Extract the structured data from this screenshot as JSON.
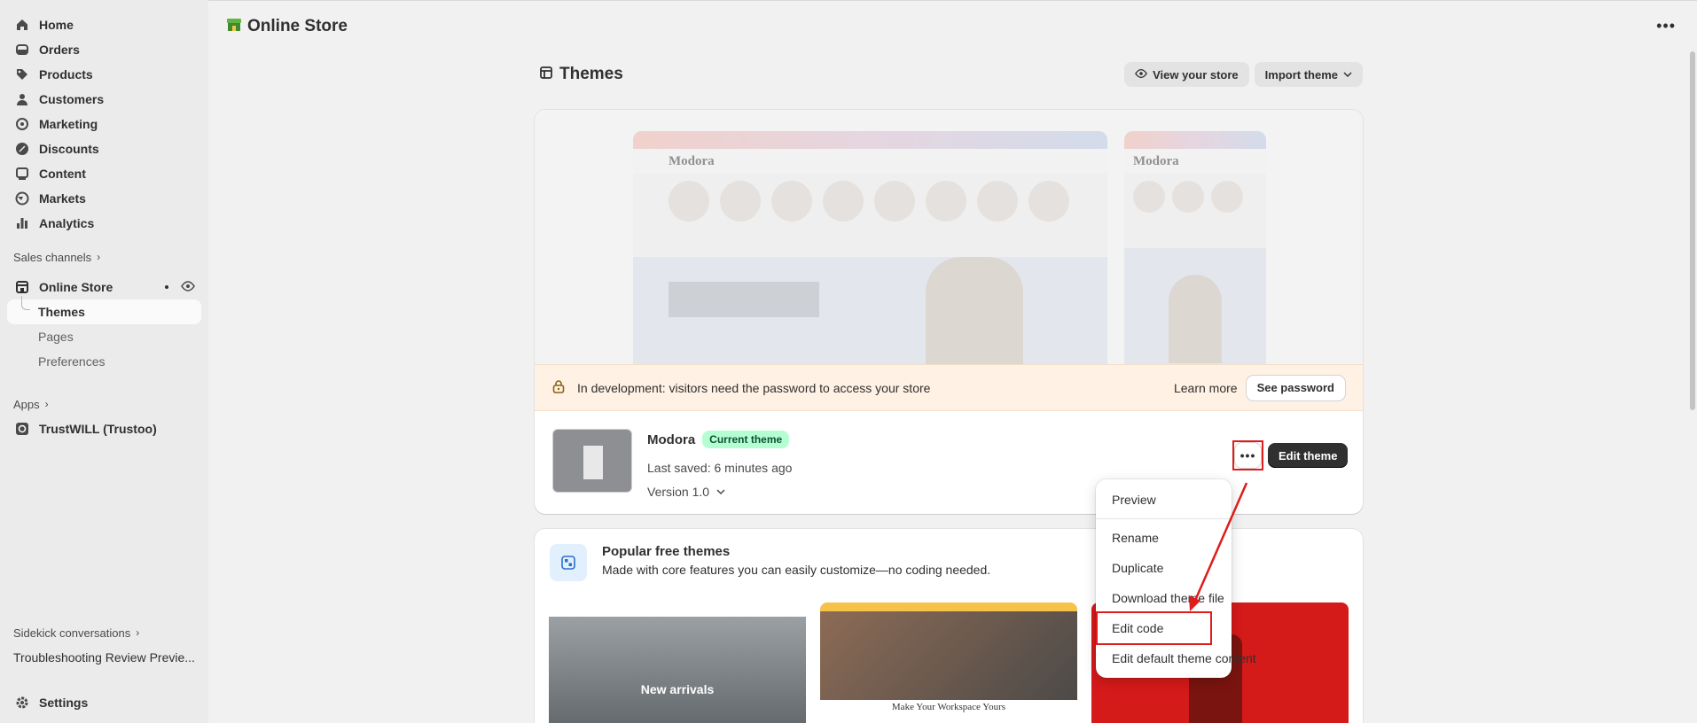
{
  "sidebar": {
    "nav": [
      {
        "label": "Home",
        "icon": "home-icon"
      },
      {
        "label": "Orders",
        "icon": "orders-icon"
      },
      {
        "label": "Products",
        "icon": "tag-icon"
      },
      {
        "label": "Customers",
        "icon": "person-icon"
      },
      {
        "label": "Marketing",
        "icon": "target-icon"
      },
      {
        "label": "Discounts",
        "icon": "discount-icon"
      },
      {
        "label": "Content",
        "icon": "content-icon"
      },
      {
        "label": "Markets",
        "icon": "globe-icon"
      },
      {
        "label": "Analytics",
        "icon": "chart-bar-icon"
      }
    ],
    "sales_channels_label": "Sales channels",
    "online_store_label": "Online Store",
    "sub_items": [
      "Themes",
      "Pages",
      "Preferences"
    ],
    "apps_label": "Apps",
    "app_item": "TrustWILL (Trustoo)",
    "sidekick_label": "Sidekick conversations",
    "conversation": "Troubleshooting Review Previe...",
    "settings_label": "Settings"
  },
  "topbar": {
    "title": "Online Store"
  },
  "page": {
    "title": "Themes",
    "view_store_label": "View your store",
    "import_label": "Import theme"
  },
  "dev_banner": {
    "text": "In development: visitors need the password to access your store",
    "learn_more": "Learn more",
    "see_password": "See password"
  },
  "theme": {
    "name": "Modora",
    "badge": "Current theme",
    "saved": "Last saved: 6 minutes ago",
    "version": "Version 1.0",
    "edit_label": "Edit theme",
    "preview_brand": "Modora"
  },
  "popular": {
    "title": "Popular free themes",
    "subtitle": "Made with core features you can easily customize—no coding needed.",
    "thumb1_caption": "New arrivals",
    "thumb2_caption": "Make Your Workspace Yours"
  },
  "menu": {
    "items": [
      "Preview",
      "Rename",
      "Duplicate",
      "Download theme file",
      "Edit code",
      "Edit default theme content"
    ]
  },
  "colors": {
    "highlight": "#e01b1b",
    "badge_bg": "#b4fed2",
    "dev_banner_bg": "#fff1e3"
  }
}
